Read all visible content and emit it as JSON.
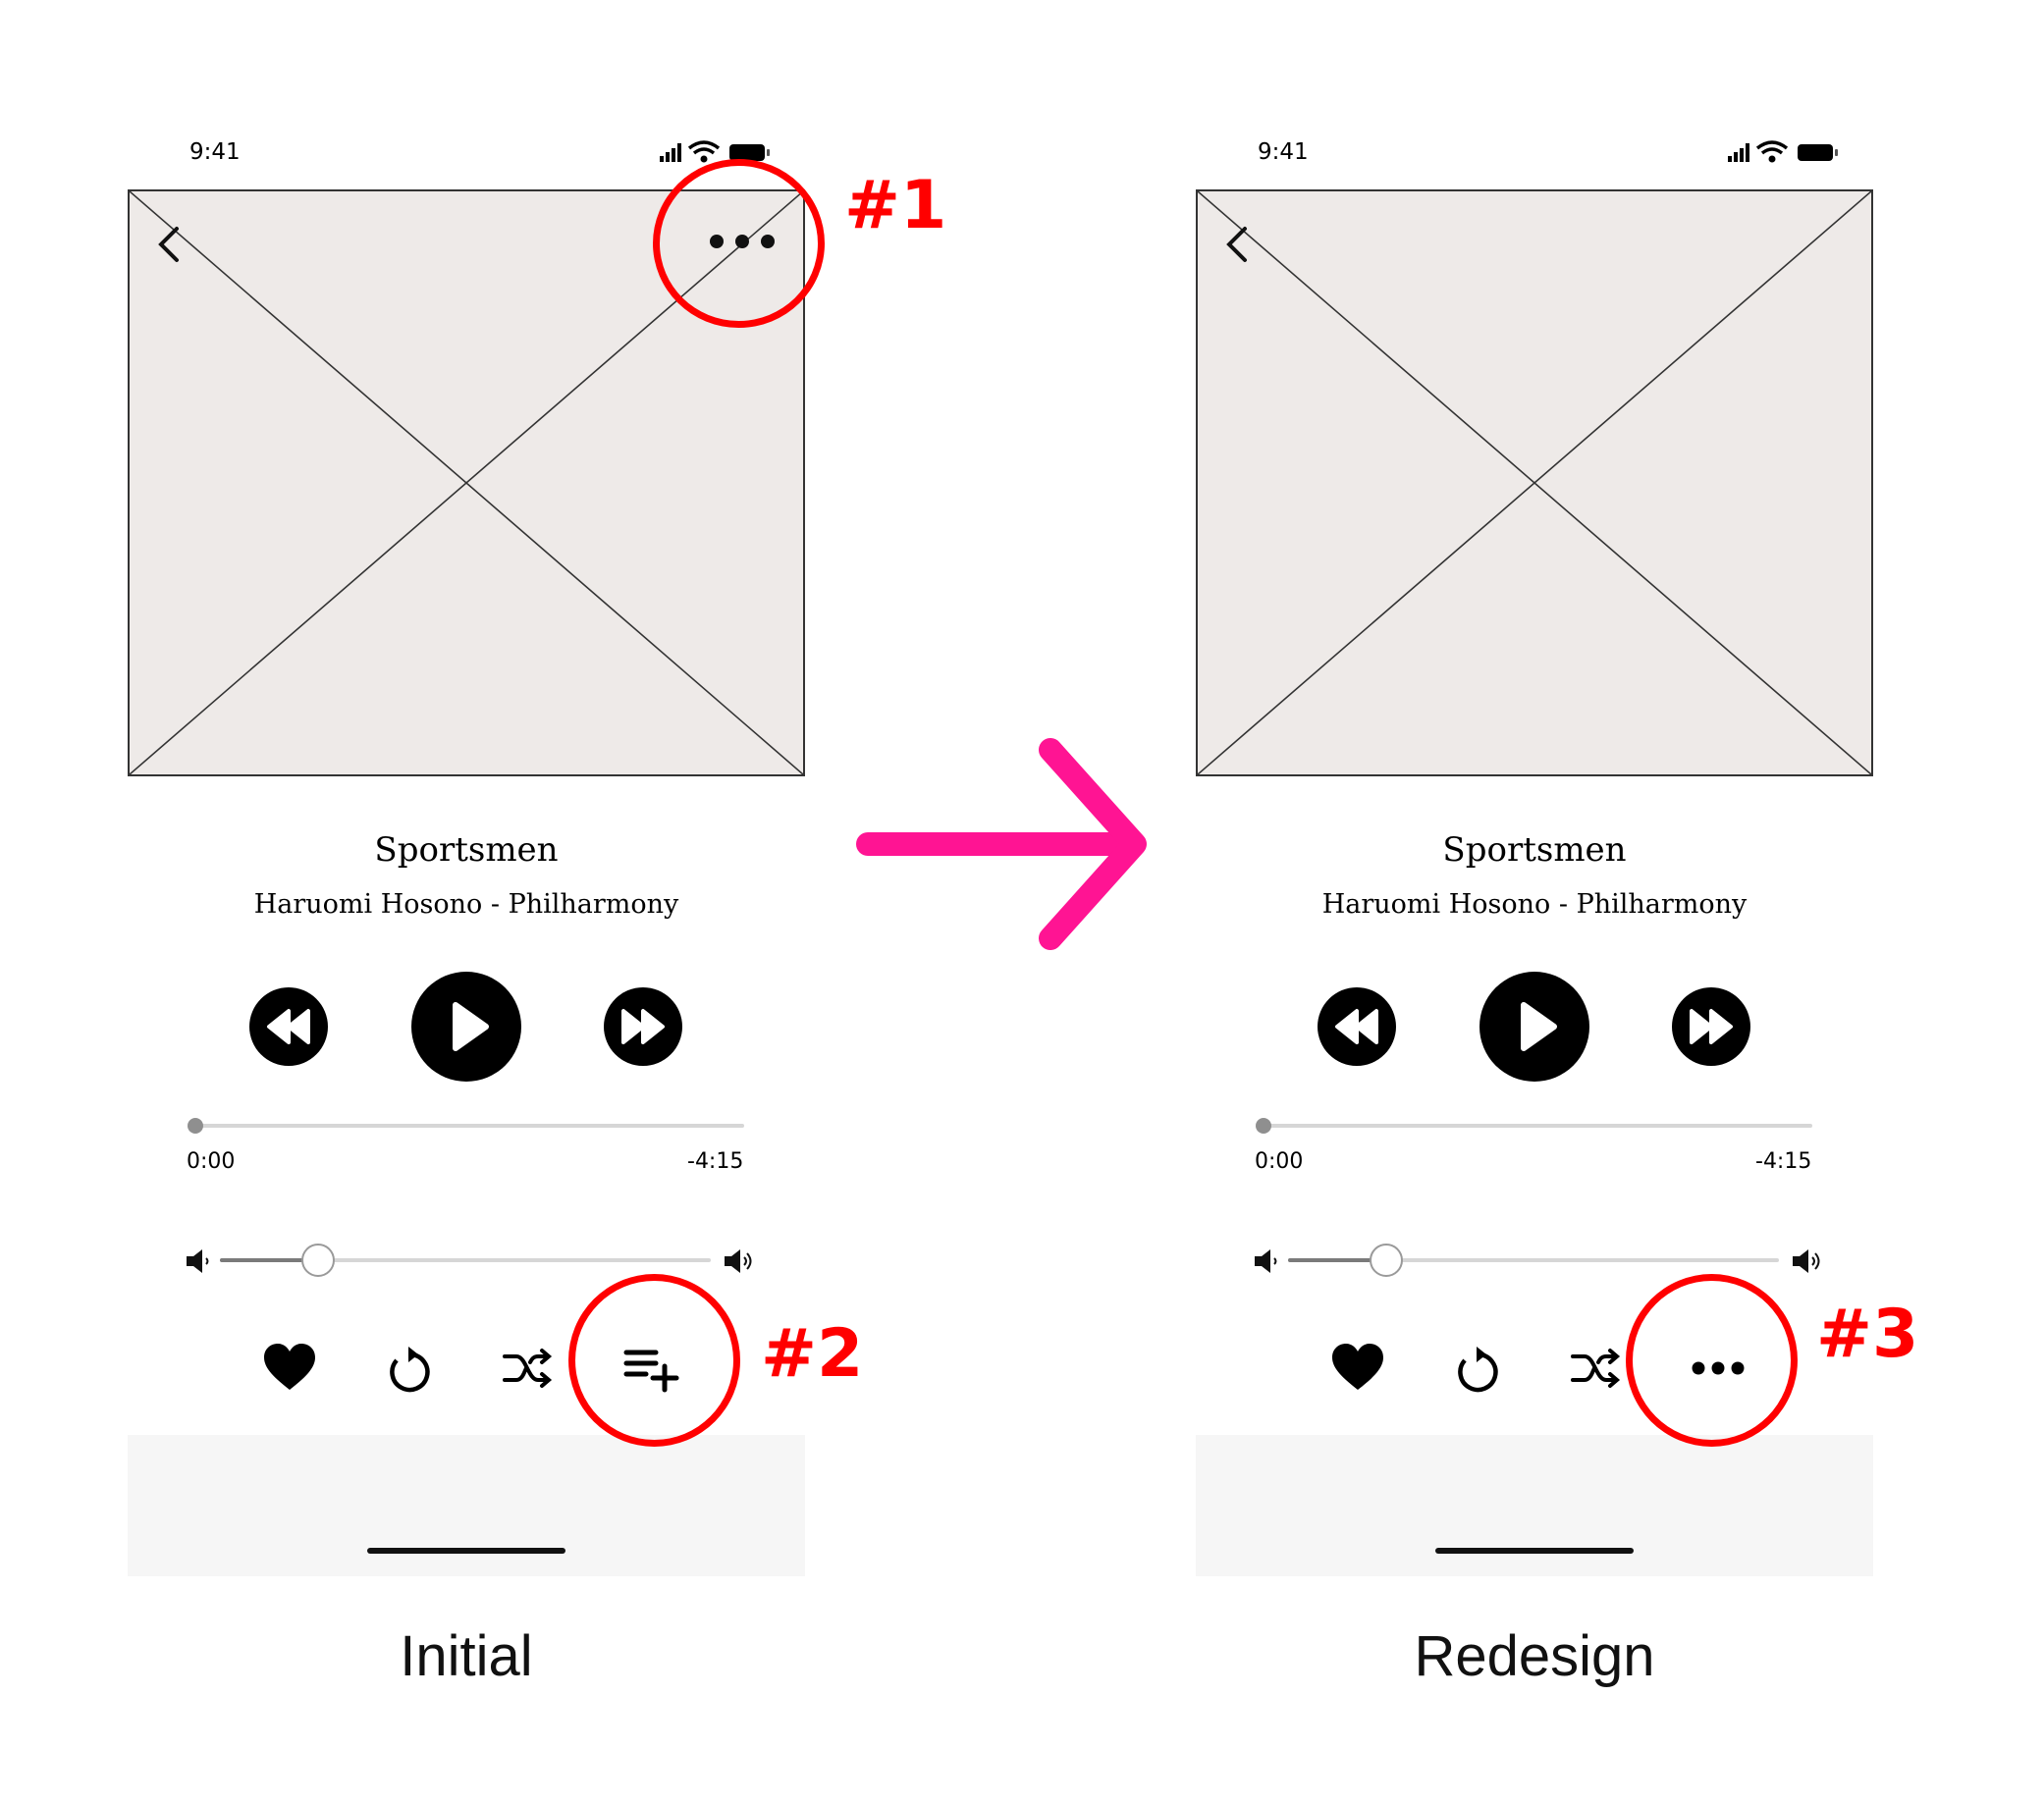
{
  "screens": [
    {
      "id": "initial",
      "status_time": "9:41",
      "song_title": "Sportsmen",
      "song_artist": "Haruomi Hosono - Philharmony",
      "time_elapsed": "0:00",
      "time_remaining": "-4:15",
      "progress": 0.0,
      "volume": 0.2,
      "top_right_button_icon": "more-horizontal-icon",
      "fourth_action_icon": "add-to-queue-icon",
      "caption": "Initial"
    },
    {
      "id": "redesign",
      "status_time": "9:41",
      "song_title": "Sportsmen",
      "song_artist": "Haruomi Hosono - Philharmony",
      "time_elapsed": "0:00",
      "time_remaining": "-4:15",
      "progress": 0.0,
      "volume": 0.2,
      "top_right_button_icon": null,
      "fourth_action_icon": "more-horizontal-icon",
      "caption": "Redesign"
    }
  ],
  "annotations": [
    {
      "label": "#1",
      "target": "initial top-right more button"
    },
    {
      "label": "#2",
      "target": "initial add-to-queue button"
    },
    {
      "label": "#3",
      "target": "redesign more button"
    }
  ],
  "colors": {
    "highlight": "#ff0000",
    "arrow": "#ff1493",
    "artwork_bg": "#eeeae8",
    "home_bar_bg": "#f6f6f6"
  },
  "arrow_icon": "right-arrow-icon"
}
